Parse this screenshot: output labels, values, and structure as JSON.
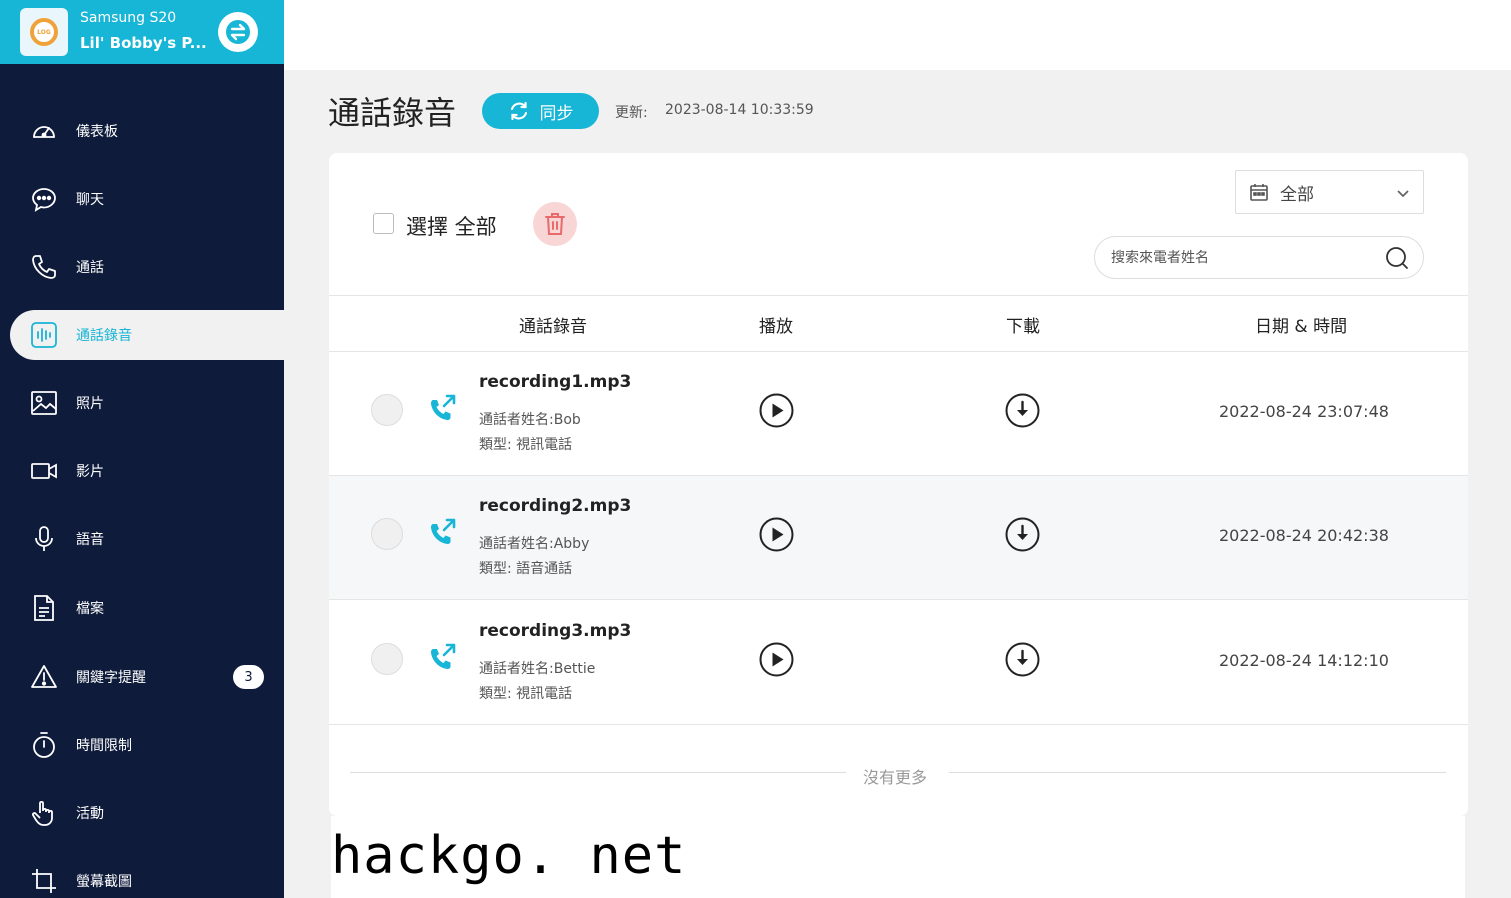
{
  "device": {
    "model": "Samsung S20",
    "owner": "Lil' Bobby's P..."
  },
  "nav": {
    "items": [
      {
        "label": "儀表板",
        "icon": "dashboard-icon"
      },
      {
        "label": "聊天",
        "icon": "chat-icon"
      },
      {
        "label": "通話",
        "icon": "phone-icon"
      },
      {
        "label": "通話錄音",
        "icon": "audio-wave-icon",
        "active": true
      },
      {
        "label": "照片",
        "icon": "image-icon"
      },
      {
        "label": "影片",
        "icon": "video-icon"
      },
      {
        "label": "語音",
        "icon": "mic-icon"
      },
      {
        "label": "檔案",
        "icon": "file-icon"
      },
      {
        "label": "關鍵字提醒",
        "icon": "warning-icon",
        "badge": "3"
      },
      {
        "label": "時間限制",
        "icon": "stopwatch-icon"
      },
      {
        "label": "活動",
        "icon": "hand-pointer-icon"
      },
      {
        "label": "螢幕截圖",
        "icon": "crop-icon"
      }
    ]
  },
  "header": {
    "title": "通話錄音",
    "sync_label": "同步",
    "update_label": "更新:",
    "update_time": "2023-08-14 10:33:59"
  },
  "toolbar": {
    "select_all_label": "選擇 全部",
    "date_filter_label": "全部",
    "search_placeholder": "搜索來電者姓名"
  },
  "table": {
    "columns": [
      "通話錄音",
      "播放",
      "下載",
      "日期 & 時間"
    ],
    "rows": [
      {
        "filename": "recording1.mp3",
        "caller": "通話者姓名:Bob",
        "type": "類型: 視訊電話",
        "datetime": "2022-08-24 23:07:48"
      },
      {
        "filename": "recording2.mp3",
        "caller": "通話者姓名:Abby",
        "type": "類型: 語音通話",
        "datetime": "2022-08-24 20:42:38"
      },
      {
        "filename": "recording3.mp3",
        "caller": "通話者姓名:Bettie",
        "type": "類型: 視訊電話",
        "datetime": "2022-08-24 14:12:10"
      }
    ],
    "no_more_label": "沒有更多"
  },
  "watermark": "hackgo. net",
  "colors": {
    "accent": "#17b5d6",
    "sidebar": "#0e1b3b",
    "delete_bg": "#f9d6d6",
    "delete_icon": "#e86a6a"
  }
}
